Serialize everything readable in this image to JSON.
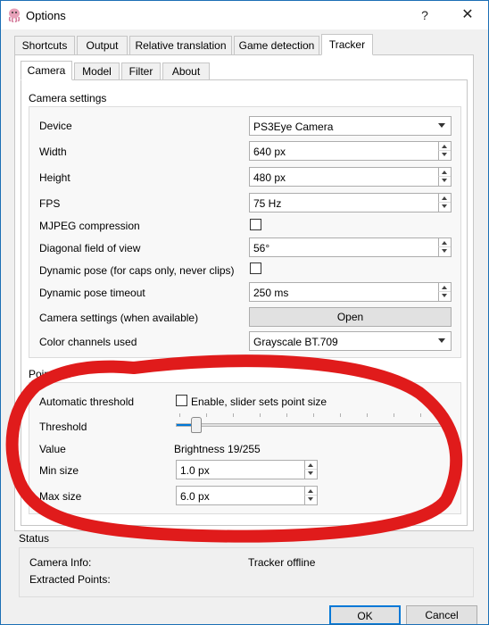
{
  "window": {
    "title": "Options",
    "help_glyph": "?",
    "close_glyph": "✕"
  },
  "top_tabs": [
    "Shortcuts",
    "Output",
    "Relative translation",
    "Game detection",
    "Tracker"
  ],
  "sub_tabs": [
    "Camera",
    "Model",
    "Filter",
    "About"
  ],
  "camera_settings": {
    "group_title": "Camera settings",
    "device_label": "Device",
    "device_value": "PS3Eye Camera",
    "width_label": "Width",
    "width_value": "640 px",
    "height_label": "Height",
    "height_value": "480 px",
    "fps_label": "FPS",
    "fps_value": "75 Hz",
    "mjpeg_label": "MJPEG compression",
    "fov_label": "Diagonal field of view",
    "fov_value": "56°",
    "dyn_pose_label": "Dynamic pose (for caps only, never clips)",
    "dyn_timeout_label": "Dynamic pose timeout",
    "dyn_timeout_value": "250 ms",
    "cam_settings_label": "Camera settings (when available)",
    "open_button": "Open",
    "color_label": "Color channels used",
    "color_value": "Grayscale BT.709"
  },
  "point_extraction": {
    "group_title_partial": "Point ext",
    "auto_threshold_label": "Automatic threshold",
    "auto_threshold_check": "Enable, slider sets point size",
    "threshold_label": "Threshold",
    "threshold_level": 0.075,
    "value_label": "Value",
    "value_text": "Brightness 19/255",
    "min_size_label": "Min size",
    "min_size_value": "1.0 px",
    "max_size_label": "Max size",
    "max_size_value": "6.0 px"
  },
  "status": {
    "title": "Status",
    "camera_info_label": "Camera Info:",
    "camera_info_value": "Tracker offline",
    "extracted_label": "Extracted Points:"
  },
  "buttons": {
    "ok": "OK",
    "cancel": "Cancel"
  },
  "annotation_color": "#e01b1b"
}
